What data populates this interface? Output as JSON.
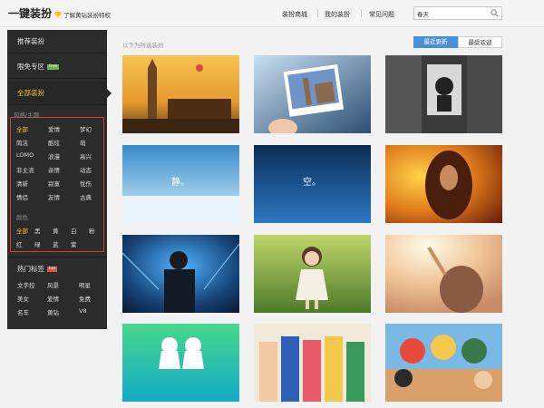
{
  "header": {
    "brand": "一键装扮",
    "vip_link": "了解黄钻装扮特权",
    "nav": [
      "装扮商城",
      "我的装扮",
      "常见问题"
    ],
    "search_value": "春天"
  },
  "sidebar": {
    "recommend": "推荐装扮",
    "free_zone": "限免专区",
    "free_badge": "free",
    "all": "全部装扮",
    "style_group_label": "风格/主题",
    "styles": [
      [
        "全部",
        "爱情",
        "梦幻"
      ],
      [
        "简洁",
        "酷炫",
        "萌"
      ],
      [
        "LOMO",
        "浪漫",
        "高兴"
      ],
      [
        "非主流",
        "亲情",
        "动态"
      ],
      [
        "清新",
        "寂寞",
        "忧伤"
      ],
      [
        "情侣",
        "友情",
        "古典"
      ]
    ],
    "color_group_label": "颜色",
    "colors": [
      "全部",
      "黑",
      "黄",
      "白",
      "粉",
      "红",
      "绿",
      "蓝",
      "紫"
    ],
    "hot_title": "热门标签",
    "hot_badge": "hot",
    "hot_tags": [
      [
        "文字控",
        "风景",
        "明星"
      ],
      [
        "美女",
        "爱情",
        "免费"
      ],
      [
        "名车",
        "黄钻",
        "V8"
      ]
    ]
  },
  "content": {
    "hint": "以下为所选装扮",
    "sort_latest": "最近更新",
    "sort_popular": "最受欢迎"
  },
  "thumbnails": [
    {
      "name": "london-sunset",
      "text": ""
    },
    {
      "name": "london-photo-in-hand",
      "text": ""
    },
    {
      "name": "poster-wall-man",
      "text": ""
    },
    {
      "name": "blue-sky-calm",
      "text": "静。"
    },
    {
      "name": "deep-blue-space",
      "text": "空。"
    },
    {
      "name": "fiery-woman",
      "text": ""
    },
    {
      "name": "blue-tech-man",
      "text": ""
    },
    {
      "name": "green-doll-girl",
      "text": ""
    },
    {
      "name": "sunlight-girl",
      "text": ""
    },
    {
      "name": "teru-teru-bozu",
      "text": ""
    },
    {
      "name": "sailor-moon-parody",
      "text": ""
    },
    {
      "name": "one-piece-crew",
      "text": ""
    }
  ],
  "colors": {
    "accent": "#f5c518",
    "sidebar_bg": "#2b2b2b",
    "sort_active": "#4a90d9",
    "filter_border": "#d43c3c"
  }
}
